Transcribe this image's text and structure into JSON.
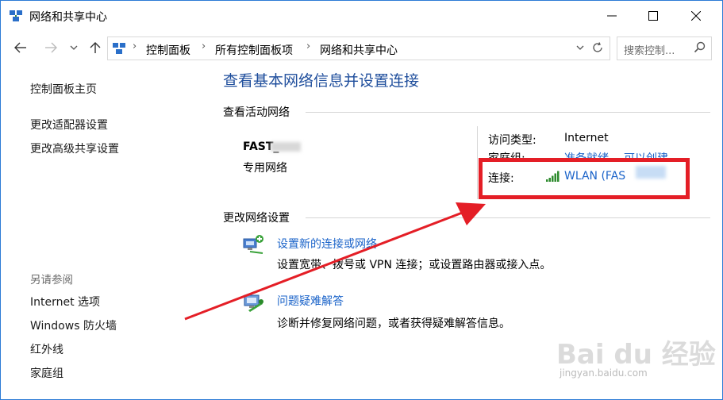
{
  "window": {
    "title": "网络和共享中心"
  },
  "address_bar": {
    "breadcrumbs": [
      "控制面板",
      "所有控制面板项",
      "网络和共享中心"
    ],
    "search_placeholder": "搜索控制..."
  },
  "left_pane": {
    "links": [
      "控制面板主页",
      "更改适配器设置",
      "更改高级共享设置"
    ],
    "see_also_heading": "另请参阅",
    "see_also_links": [
      "Internet 选项",
      "Windows 防火墙",
      "红外线",
      "家庭组"
    ]
  },
  "main": {
    "title": "查看基本网络信息并设置连接",
    "active_networks_heading": "查看活动网络",
    "network": {
      "name": "FAST_",
      "category": "专用网络",
      "access_type_label": "访问类型:",
      "access_type_value": "Internet",
      "homegroup_label": "家庭组:",
      "homegroup_ready": "准备就绪",
      "homegroup_create": "可以创建",
      "connection_label": "连接:",
      "connection_value": "WLAN (FAS"
    },
    "change_settings_heading": "更改网络设置",
    "tasks": [
      {
        "link": "设置新的连接或网络",
        "desc": "设置宽带、拨号或 VPN 连接；或设置路由器或接入点。"
      },
      {
        "link": "问题疑难解答",
        "desc": "诊断并修复网络问题，或者获得疑难解答信息。"
      }
    ]
  },
  "watermark": {
    "brand": "Bai du 经验",
    "url": "jingyan.baidu.com"
  },
  "colors": {
    "accent": "#1a63c9",
    "title_blue": "#1f4e9c",
    "annotation_red": "#e41e26"
  }
}
